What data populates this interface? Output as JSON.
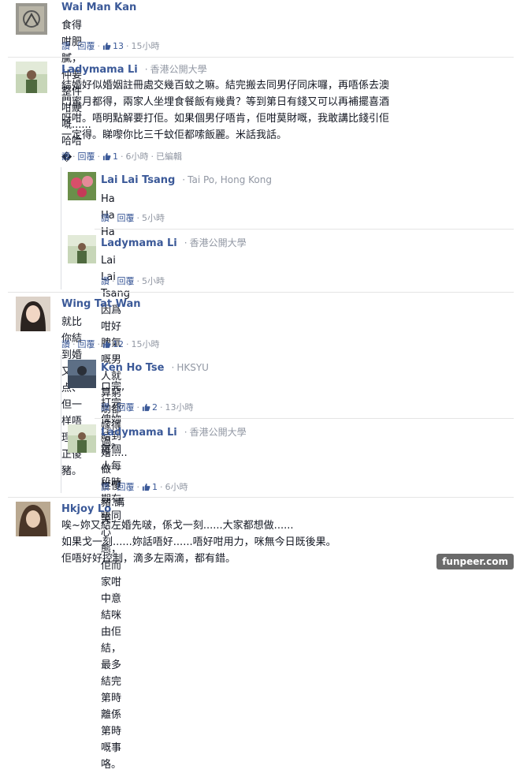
{
  "comments": [
    {
      "name": "Wai Man Kan",
      "affiliation": "",
      "text": "食得咁肥膩，仲要整件咁鯁嘅......哈哈�",
      "actions": {
        "like": "讚",
        "reply": "回覆",
        "likes": "13",
        "time": "15小時",
        "edited": ""
      }
    },
    {
      "name": "Ladymama Li",
      "affiliation": "香港公開大學",
      "text": "結婚好似婚姻註冊處交幾百蚊之嘛。結完搬去同男仔同床囉，再唔係去澳\n門蜜月都得，兩家人坐埋食餐飯有幾貴？等到第日有錢又可以再補擺喜酒\n呀咁。唔明點解要打佢。如果個男仔唔肯，佢咁莫財嘅，我敢講比錢引佢\n一定得。睇嚟你比三千蚊佢都嗦飯麗。米話我話。",
      "actions": {
        "like": "讚",
        "reply": "回覆",
        "likes": "1",
        "time": "6小時",
        "edited": "已編輯"
      }
    },
    {
      "name": "Lai Lai Tsang",
      "affiliation": "Tai Po, Hong Kong",
      "text": "Ha Ha Ha",
      "actions": {
        "like": "讚",
        "reply": "回覆",
        "likes": "",
        "time": "5小時",
        "edited": ""
      }
    },
    {
      "name": "Ladymama Li",
      "affiliation": "香港公開大學",
      "text": "Lai Lai Tsang 因爲咁好脾氣嘅男人就算窮啲都嫁得過。",
      "actions": {
        "like": "讚",
        "reply": "回覆",
        "likes": "",
        "time": "5小時",
        "edited": ""
      }
    },
    {
      "name": "Wing Tat Wan",
      "affiliation": "",
      "text": "就比你結到婚又点、但一样唔理你正傻豬。",
      "actions": {
        "like": "讚",
        "reply": "回覆",
        "likes": "12",
        "time": "15小時",
        "edited": ""
      }
    },
    {
      "name": "Ken Ho Tse",
      "affiliation": "HKSYU",
      "text": "ロ完,打完,俾妳結到婚.....做一世傻豬.講笑.",
      "actions": {
        "like": "讚",
        "reply": "回覆",
        "likes": "2",
        "time": "13小時",
        "edited": ""
      }
    },
    {
      "name": "Ladymama Li",
      "affiliation": "香港公開大學",
      "text": "每個人每段時期有唔同心態，佢而家咁中意結咪由佢結，最多結完\n第時離係第時嘅事咯。",
      "actions": {
        "like": "讚",
        "reply": "回覆",
        "likes": "1",
        "time": "6小時",
        "edited": ""
      }
    },
    {
      "name": "Hkjoy Lo",
      "affiliation": "",
      "text": "唉~妳又結左婚先啵，係戈一刻......大家都想做......\n如果戈一刻......妳話唔好......唔好咁用力，咪無今日既後果。\n佢唔好好控制，滴多左兩滴，都有錯。",
      "actions": {
        "like": "",
        "reply": "",
        "likes": "",
        "time": "",
        "edited": ""
      }
    }
  ],
  "watermark": "funpeer.com",
  "colors": {
    "name": "#3b5998",
    "meta": "#9197a3",
    "text": "#141823"
  },
  "icons": [
    "like-thumb-icon"
  ]
}
